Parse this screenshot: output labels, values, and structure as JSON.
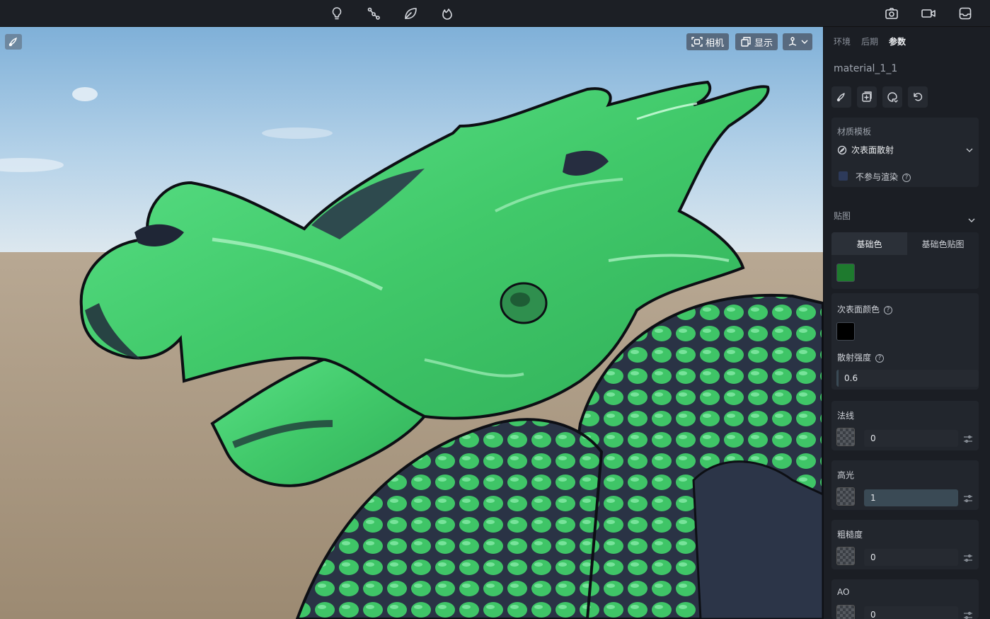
{
  "toolbar": {
    "icons": [
      "light-bulb-icon",
      "node-graph-icon",
      "leaf-icon",
      "flame-icon",
      "camera-icon",
      "video-icon",
      "inbox-icon"
    ]
  },
  "viewport": {
    "camera_label": "相机",
    "display_label": "显示"
  },
  "panel": {
    "tabs": [
      {
        "label": "环境",
        "active": false
      },
      {
        "label": "后期",
        "active": false
      },
      {
        "label": "参数",
        "active": true
      }
    ],
    "material_name": "material_1_1",
    "template": {
      "title": "材质模板",
      "selected": "次表面散射",
      "no_render_label": "不参与渲染"
    },
    "maps": {
      "title": "贴图",
      "tab_base_color": "基础色",
      "tab_base_color_map": "基础色贴图",
      "base_color": "#1e7a2e"
    },
    "subsurface": {
      "color_label": "次表面颜色",
      "color": "#000000",
      "scatter_label": "散射强度",
      "scatter_value": "0.6"
    },
    "normal": {
      "label": "法线",
      "value": "0"
    },
    "specular": {
      "label": "高光",
      "value": "1"
    },
    "roughness": {
      "label": "粗糙度",
      "value": "0"
    },
    "ao": {
      "label": "AO",
      "value": "0"
    }
  }
}
